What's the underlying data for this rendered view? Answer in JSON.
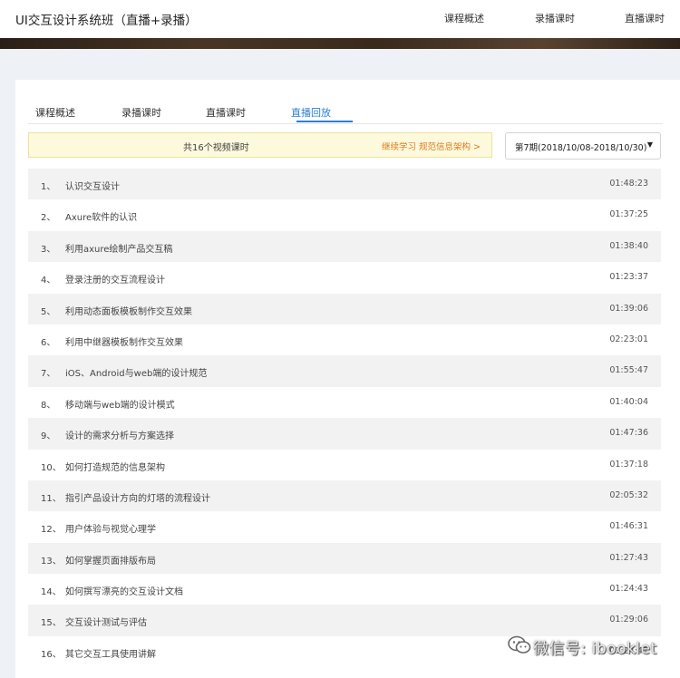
{
  "header": {
    "course_title": "UI交互设计系统班（直播+录播）",
    "nav": [
      "课程概述",
      "录播课时",
      "直播课时"
    ]
  },
  "tabs": [
    {
      "label": "课程概述",
      "active": false
    },
    {
      "label": "录播课时",
      "active": false
    },
    {
      "label": "直播课时",
      "active": false
    },
    {
      "label": "直播回放",
      "active": true
    }
  ],
  "notice": {
    "text": "共16个视频课时",
    "link": "继续学习 规范信息架构 >"
  },
  "period_select": {
    "value": "第7期(2018/10/08-2018/10/30)",
    "caret": "▼"
  },
  "lessons": [
    {
      "num": "1、",
      "title": "认识交互设计",
      "duration": "01:48:23"
    },
    {
      "num": "2、",
      "title": "Axure软件的认识",
      "duration": "01:37:25"
    },
    {
      "num": "3、",
      "title": "利用axure绘制产品交互稿",
      "duration": "01:38:40"
    },
    {
      "num": "4、",
      "title": "登录注册的交互流程设计",
      "duration": "01:23:37"
    },
    {
      "num": "5、",
      "title": "利用动态面板模板制作交互效果",
      "duration": "01:39:06"
    },
    {
      "num": "6、",
      "title": "利用中继器模板制作交互效果",
      "duration": "02:23:01"
    },
    {
      "num": "7、",
      "title": "iOS、Android与web端的设计规范",
      "duration": "01:55:47"
    },
    {
      "num": "8、",
      "title": "移动端与web端的设计模式",
      "duration": "01:40:04"
    },
    {
      "num": "9、",
      "title": "设计的需求分析与方案选择",
      "duration": "01:47:36"
    },
    {
      "num": "10、",
      "title": "如何打造规范的信息架构",
      "duration": "01:37:18"
    },
    {
      "num": "11、",
      "title": "指引产品设计方向的灯塔的流程设计",
      "duration": "02:05:32"
    },
    {
      "num": "12、",
      "title": "用户体验与视觉心理学",
      "duration": "01:46:31"
    },
    {
      "num": "13、",
      "title": "如何掌握页面排版布局",
      "duration": "01:27:43"
    },
    {
      "num": "14、",
      "title": "如何撰写漂亮的交互设计文档",
      "duration": "01:24:43"
    },
    {
      "num": "15、",
      "title": "交互设计测试与评估",
      "duration": "01:29:06"
    },
    {
      "num": "16、",
      "title": "其它交互工具使用讲解",
      "duration": "01:24:47"
    }
  ],
  "watermark": {
    "text": "微信号: ibooklet",
    "icon": "wechat-icon"
  },
  "colors": {
    "accent": "#2b7fd7",
    "notice_bg": "#fdf9dc",
    "notice_link": "#e07b1c",
    "page_bg": "#eef2f6",
    "row_alt": "#f2f2f2"
  }
}
